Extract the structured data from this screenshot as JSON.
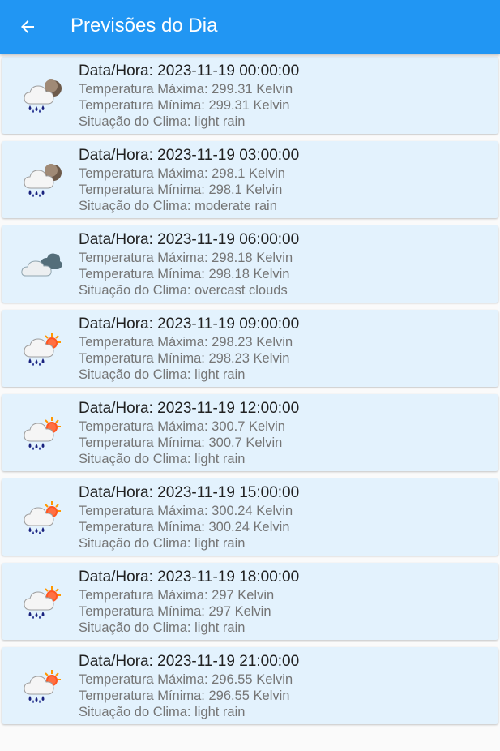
{
  "appbar": {
    "back_icon": "arrow-left-icon",
    "title": "Previsões do Dia",
    "color": "#2196f3"
  },
  "forecasts": [
    {
      "icon": "rain-night-icon",
      "datetime": "Data/Hora: 2023-11-19 00:00:00",
      "temp_max": "Temperatura Máxima: 299.31 Kelvin",
      "temp_min": "Temperatura Mínima: 299.31 Kelvin",
      "weather": "Situação do Clima: light rain"
    },
    {
      "icon": "rain-night-icon",
      "datetime": "Data/Hora: 2023-11-19 03:00:00",
      "temp_max": "Temperatura Máxima: 298.1 Kelvin",
      "temp_min": "Temperatura Mínima: 298.1 Kelvin",
      "weather": "Situação do Clima: moderate rain"
    },
    {
      "icon": "overcast-clouds-icon",
      "datetime": "Data/Hora: 2023-11-19 06:00:00",
      "temp_max": "Temperatura Máxima: 298.18 Kelvin",
      "temp_min": "Temperatura Mínima: 298.18 Kelvin",
      "weather": "Situação do Clima: overcast clouds"
    },
    {
      "icon": "rain-day-icon",
      "datetime": "Data/Hora: 2023-11-19 09:00:00",
      "temp_max": "Temperatura Máxima: 298.23 Kelvin",
      "temp_min": "Temperatura Mínima: 298.23 Kelvin",
      "weather": "Situação do Clima: light rain"
    },
    {
      "icon": "rain-day-icon",
      "datetime": "Data/Hora: 2023-11-19 12:00:00",
      "temp_max": "Temperatura Máxima: 300.7 Kelvin",
      "temp_min": "Temperatura Mínima: 300.7 Kelvin",
      "weather": "Situação do Clima: light rain"
    },
    {
      "icon": "rain-day-icon",
      "datetime": "Data/Hora: 2023-11-19 15:00:00",
      "temp_max": "Temperatura Máxima: 300.24 Kelvin",
      "temp_min": "Temperatura Mínima: 300.24 Kelvin",
      "weather": "Situação do Clima: light rain"
    },
    {
      "icon": "rain-day-icon",
      "datetime": "Data/Hora: 2023-11-19 18:00:00",
      "temp_max": "Temperatura Máxima: 297 Kelvin",
      "temp_min": "Temperatura Mínima: 297 Kelvin",
      "weather": "Situação do Clima: light rain"
    },
    {
      "icon": "rain-day-icon",
      "datetime": "Data/Hora: 2023-11-19 21:00:00",
      "temp_max": "Temperatura Máxima: 296.55 Kelvin",
      "temp_min": "Temperatura Mínima: 296.55 Kelvin",
      "weather": "Situação do Clima: light rain"
    }
  ]
}
